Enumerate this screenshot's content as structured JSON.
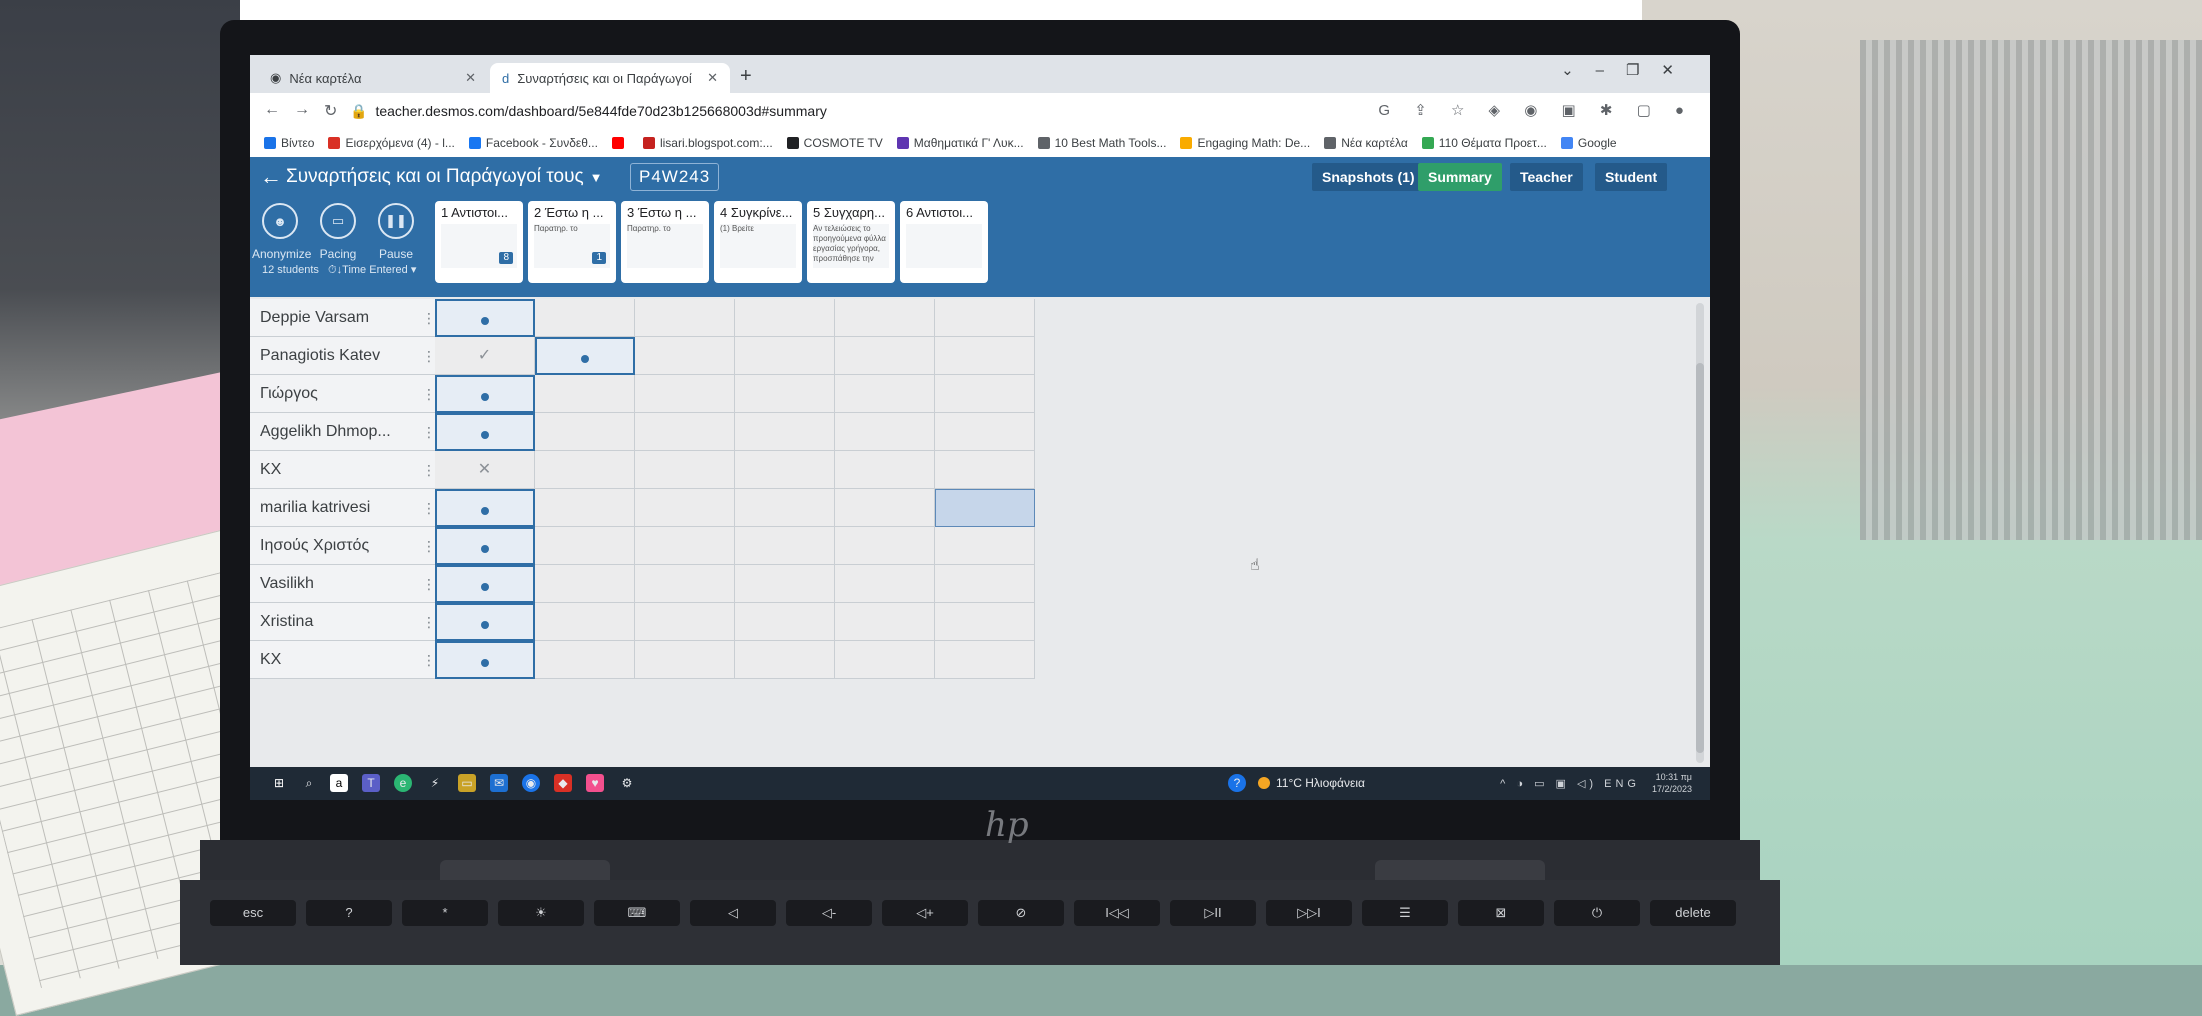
{
  "browser": {
    "tabs": [
      {
        "label": "Νέα καρτέλα",
        "active": false
      },
      {
        "label": "Συναρτήσεις και οι Παράγωγοί",
        "active": true
      }
    ],
    "new_tab": "+",
    "url": "teacher.desmos.com/dashboard/5e844fde70d23b125668003d#summary",
    "bookmarks": [
      {
        "label": "Βίντεο",
        "color": "#1a73e8"
      },
      {
        "label": "Εισερχόμενα (4) - l...",
        "color": "#d93025"
      },
      {
        "label": "Facebook - Συνδεθ...",
        "color": "#1877f2"
      },
      {
        "label": "",
        "color": "#ff0000"
      },
      {
        "label": "lisari.blogspot.com:...",
        "color": "#c5221f"
      },
      {
        "label": "COSMOTE TV",
        "color": "#202124"
      },
      {
        "label": "Μαθηματικά Γ' Λυκ...",
        "color": "#5e35b1"
      },
      {
        "label": "10 Best Math Tools...",
        "color": "#5f6368"
      },
      {
        "label": "Engaging Math: De...",
        "color": "#f9ab00"
      },
      {
        "label": "Νέα καρτέλα",
        "color": "#5f6368"
      },
      {
        "label": "110 Θέματα Προετ...",
        "color": "#34a853"
      },
      {
        "label": "Google",
        "color": "#4285f4"
      }
    ]
  },
  "desmos": {
    "activity_title": "Συναρτήσεις και οι Παράγωγοί τους",
    "class_code": "P4W243",
    "header_buttons": {
      "snapshots": "Snapshots (1)",
      "summary": "Summary",
      "teacher": "Teacher",
      "student": "Student"
    },
    "tools": [
      {
        "label": "Anonymize"
      },
      {
        "label": "Pacing"
      },
      {
        "label": "Pause"
      }
    ],
    "class_meta": {
      "students": "12 students",
      "sort": "Time Entered"
    },
    "screens": [
      {
        "title": "1 Αντιστοι...",
        "thumb": "",
        "count": "8"
      },
      {
        "title": "2 Έστω η ...",
        "thumb": "Παρατηρ. το",
        "count": "1"
      },
      {
        "title": "3 Έστω η ...",
        "thumb": "Παρατηρ. το",
        "count": ""
      },
      {
        "title": "4 Συγκρίνε...",
        "thumb": "(1) Βρείτε",
        "count": ""
      },
      {
        "title": "5 Συγχαρη...",
        "thumb": "Αν τελειώσεις το προηγούμενα φύλλα εργασίας γρήγορα, προσπάθησε την",
        "count": ""
      },
      {
        "title": "6 Αντιστοι...",
        "thumb": "",
        "count": ""
      }
    ],
    "students": [
      {
        "name": "Deppie Varsam",
        "current": 0,
        "done": [],
        "absent": []
      },
      {
        "name": "Panagiotis Katev",
        "current": 1,
        "done": [
          0
        ],
        "absent": []
      },
      {
        "name": "Γιώργος",
        "current": 0,
        "done": [],
        "absent": []
      },
      {
        "name": "Aggelikh Dhmop...",
        "current": 0,
        "done": [],
        "absent": []
      },
      {
        "name": "KX",
        "current": -1,
        "done": [],
        "absent": [
          0
        ]
      },
      {
        "name": "marilia katrivesi",
        "current": 0,
        "done": [],
        "absent": [],
        "highlight": 5
      },
      {
        "name": "Ιησούς Χριστός",
        "current": 0,
        "done": [],
        "absent": []
      },
      {
        "name": "Vasilikh",
        "current": 0,
        "done": [],
        "absent": []
      },
      {
        "name": "Xristina",
        "current": 0,
        "done": [],
        "absent": []
      },
      {
        "name": "KX",
        "current": 0,
        "done": [],
        "absent": []
      }
    ],
    "symbols": {
      "check": "✓",
      "cross": "✕",
      "kebab": "⋮"
    }
  },
  "taskbar": {
    "weather": "11°C Ηλιοφάνεια",
    "lang": "ENG",
    "time": "10:31 πμ",
    "date": "17/2/2023"
  },
  "device": {
    "brand": "hp"
  },
  "keyboard": {
    "keys": [
      "esc",
      "?",
      "*",
      "☀",
      "⌨",
      "◁",
      "◁-",
      "◁+",
      "⊘",
      "I◁◁",
      "▷II",
      "▷▷I",
      "☰",
      "⊠",
      "⏻",
      "delete"
    ]
  },
  "colors": {
    "desmos_blue": "#2f6ea6",
    "summary_green": "#2f9e6a"
  },
  "icons": {
    "anonymize": "person-icon",
    "pacing": "pacing-icon",
    "pause": "pause-icon"
  }
}
